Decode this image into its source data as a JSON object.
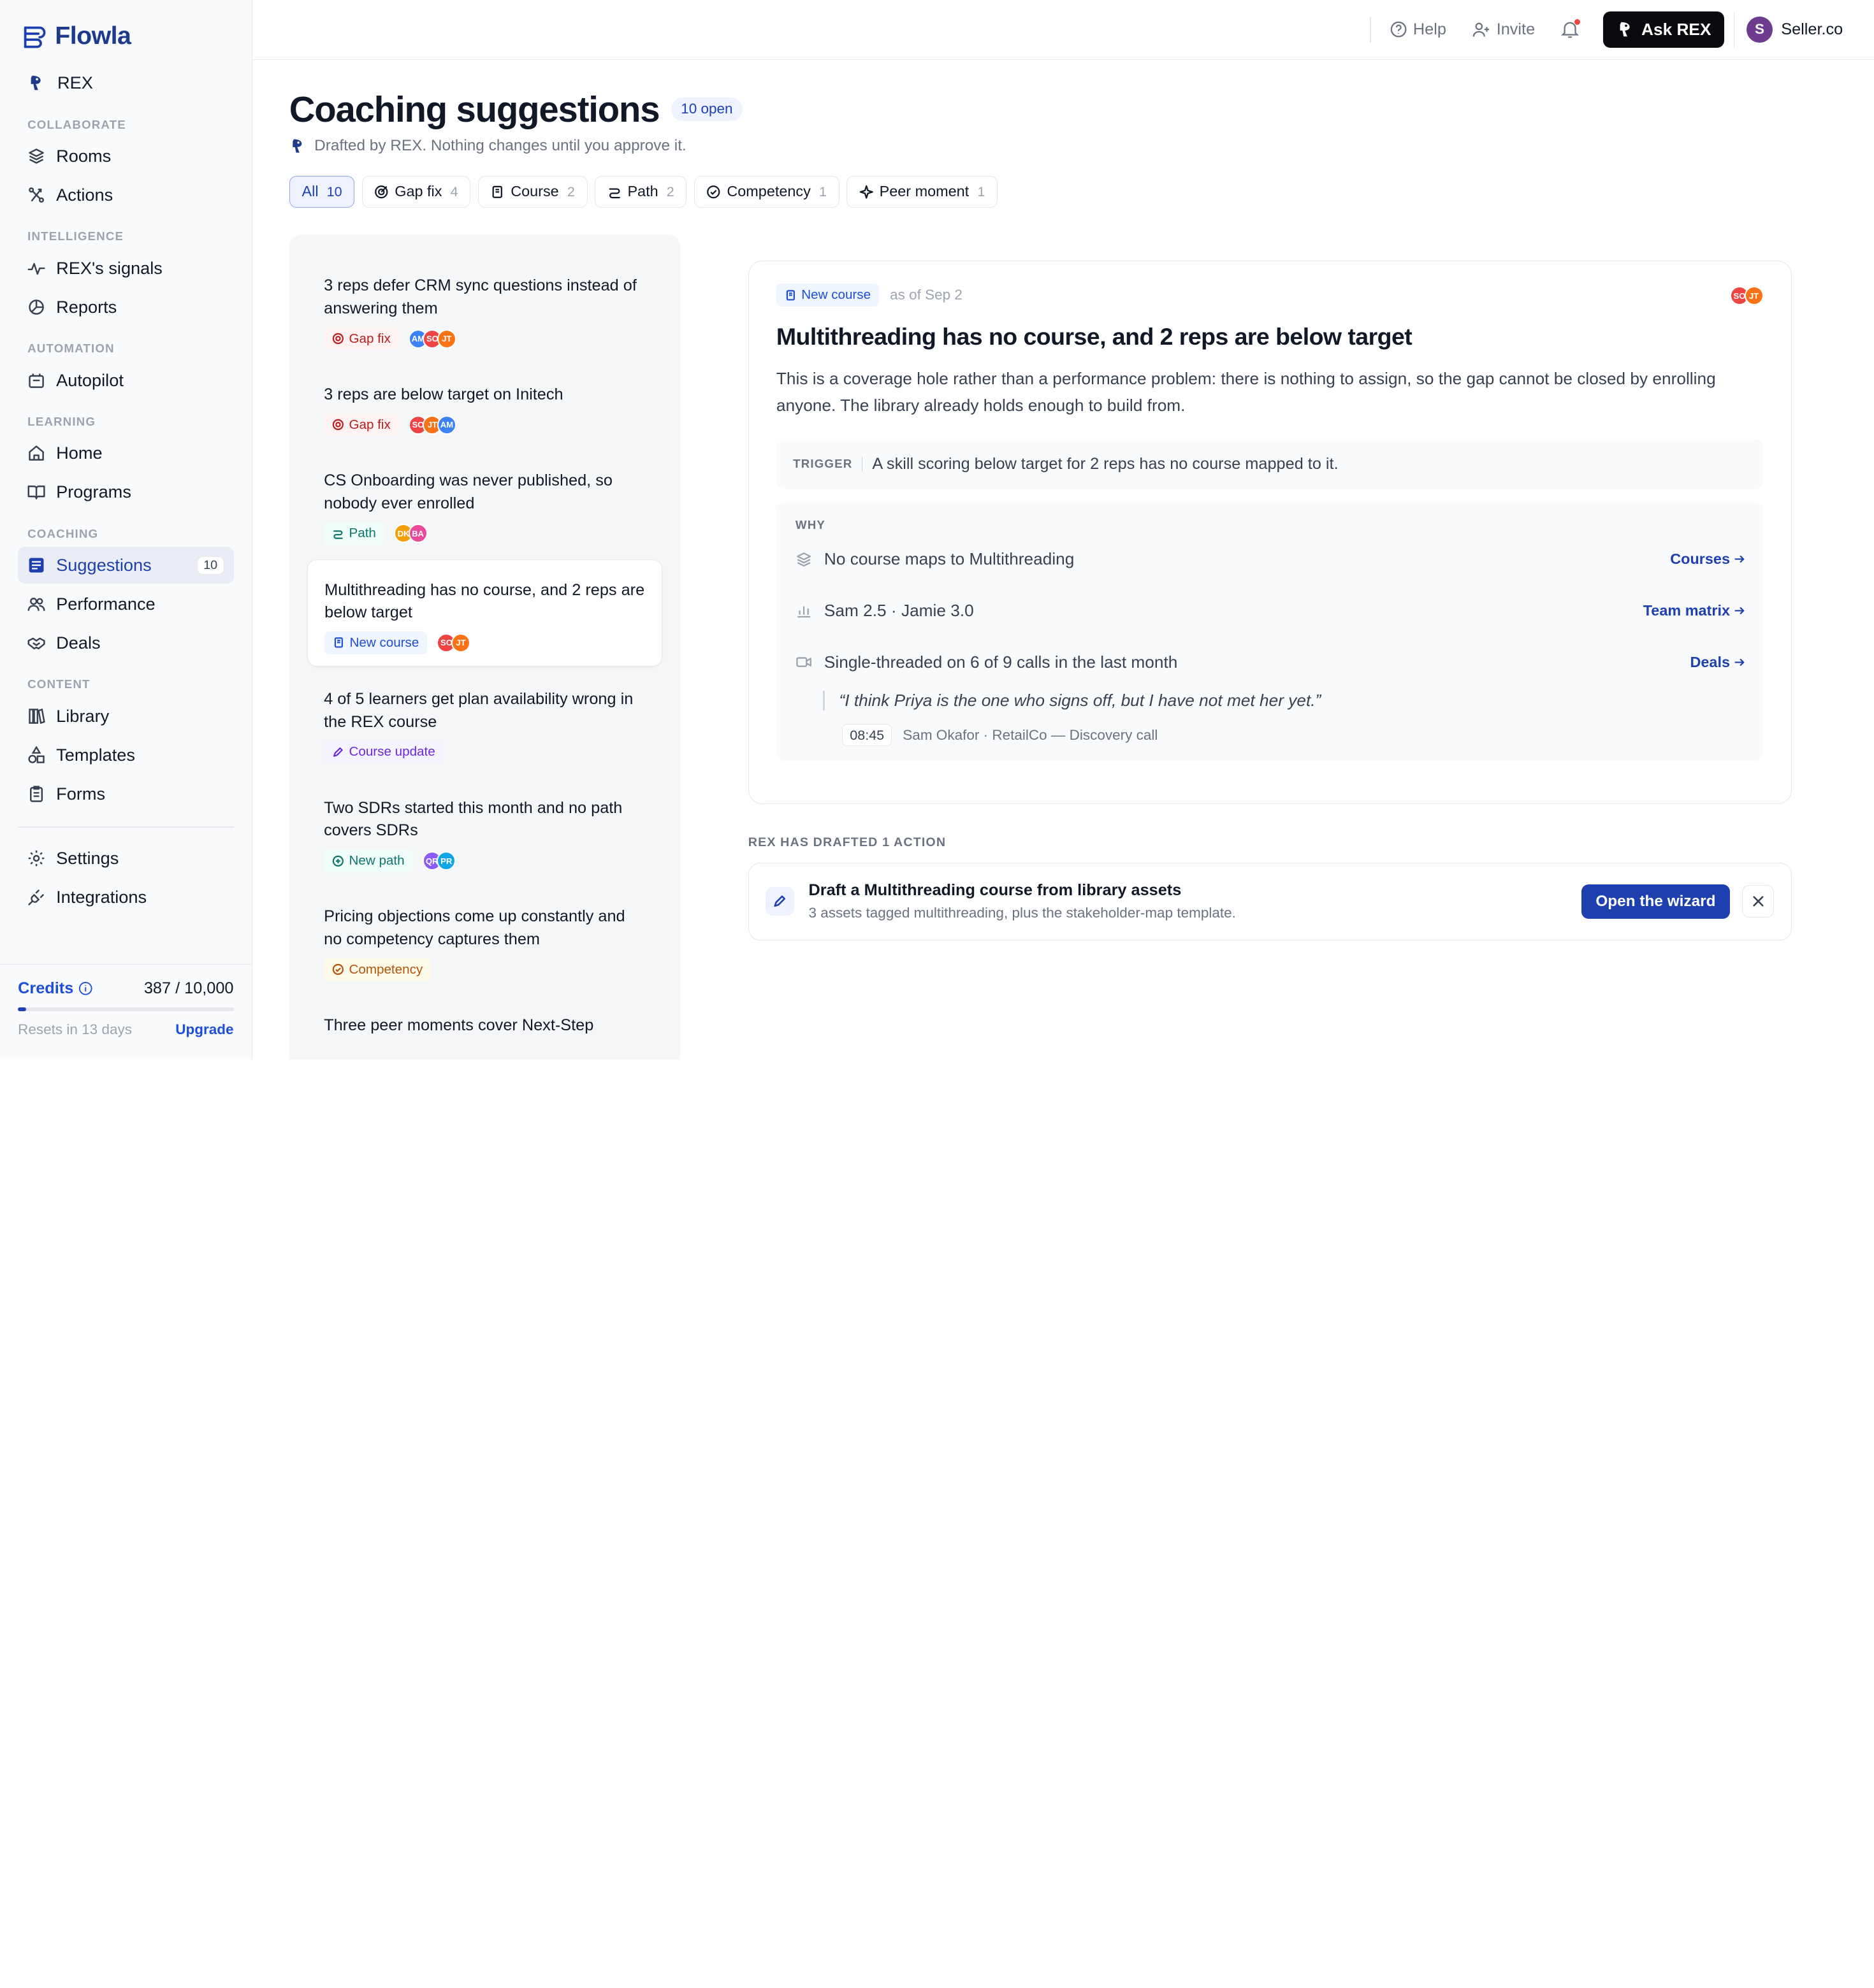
{
  "app": {
    "name": "Flowla"
  },
  "sidebar": {
    "rex": "REX",
    "sections": {
      "collaborate": "COLLABORATE",
      "intelligence": "INTELLIGENCE",
      "automation": "AUTOMATION",
      "learning": "LEARNING",
      "coaching": "COACHING",
      "content": "CONTENT"
    },
    "items": {
      "rooms": "Rooms",
      "actions": "Actions",
      "signals": "REX's signals",
      "reports": "Reports",
      "autopilot": "Autopilot",
      "home": "Home",
      "programs": "Programs",
      "suggestions": "Suggestions",
      "suggestions_count": "10",
      "performance": "Performance",
      "deals": "Deals",
      "library": "Library",
      "templates": "Templates",
      "forms": "Forms",
      "settings": "Settings",
      "integrations": "Integrations"
    },
    "credits": {
      "label": "Credits",
      "value": "387 / 10,000",
      "used_fraction": 0.0387,
      "resets": "Resets in 13 days",
      "upgrade": "Upgrade"
    }
  },
  "topbar": {
    "help": "Help",
    "invite": "Invite",
    "ask": "Ask REX",
    "org": "Seller.co",
    "org_initial": "S"
  },
  "page": {
    "title": "Coaching suggestions",
    "open_count": "10 open",
    "subtitle": "Drafted by REX. Nothing changes until you approve it."
  },
  "filters": [
    {
      "label": "All",
      "count": "10"
    },
    {
      "label": "Gap fix",
      "count": "4"
    },
    {
      "label": "Course",
      "count": "2"
    },
    {
      "label": "Path",
      "count": "2"
    },
    {
      "label": "Competency",
      "count": "1"
    },
    {
      "label": "Peer moment",
      "count": "1"
    }
  ],
  "suggestions": [
    {
      "title": "3 reps defer CRM sync questions instead of answering them",
      "tag": "Gap fix",
      "avatars": [
        "AM",
        "SO",
        "JT"
      ]
    },
    {
      "title": "3 reps are below target on Initech",
      "tag": "Gap fix",
      "avatars": [
        "SO",
        "JT",
        "AM"
      ]
    },
    {
      "title": "CS Onboarding was never published, so nobody ever enrolled",
      "tag": "Path",
      "avatars": [
        "DK",
        "BA"
      ]
    },
    {
      "title": "Multithreading has no course, and 2 reps are below target",
      "tag": "New course",
      "avatars": [
        "SO",
        "JT"
      ]
    },
    {
      "title": "4 of 5 learners get plan availability wrong in the REX course",
      "tag": "Course update",
      "avatars": []
    },
    {
      "title": "Two SDRs started this month and no path covers SDRs",
      "tag": "New path",
      "avatars": [
        "QR",
        "PR"
      ]
    },
    {
      "title": "Pricing objections come up constantly and no competency captures them",
      "tag": "Competency",
      "avatars": []
    },
    {
      "title": "Three peer moments cover Next-Step",
      "tag": "",
      "avatars": []
    }
  ],
  "detail": {
    "tag": "New course",
    "as_of": "as of Sep 2",
    "avatars": [
      "SO",
      "JT"
    ],
    "title": "Multithreading has no course, and 2 reps are below target",
    "description": "This is a coverage hole rather than a performance problem: there is nothing to assign, so the gap cannot be closed by enrolling anyone. The library already holds enough to build from.",
    "trigger_label": "TRIGGER",
    "trigger": "A skill scoring below target for 2 reps has no course mapped to it.",
    "why_label": "WHY",
    "why": [
      {
        "text": "No course maps to Multithreading",
        "link": "Courses"
      },
      {
        "text": "Sam 2.5 · Jamie 3.0",
        "link": "Team matrix"
      },
      {
        "text": "Single-threaded on 6 of 9 calls in the last month",
        "link": "Deals"
      }
    ],
    "quote": "“I think Priya is the one who signs off, but I have not met her yet.”",
    "timestamp": "08:45",
    "source": "Sam Okafor · RetailCo — Discovery call"
  },
  "action": {
    "label": "REX HAS DRAFTED 1 ACTION",
    "title": "Draft a Multithreading course from library assets",
    "subtitle": "3 assets tagged multithreading, plus the stakeholder-map template.",
    "button": "Open the wizard"
  },
  "colors": {
    "brand": "#1e40af",
    "accent": "#1d4ed8",
    "avatars": {
      "AM": "#3b82f6",
      "SO": "#ef4444",
      "JT": "#f97316",
      "DK": "#f59e0b",
      "BA": "#ec4899",
      "QR": "#8b5cf6",
      "PR": "#0ea5e9"
    }
  }
}
